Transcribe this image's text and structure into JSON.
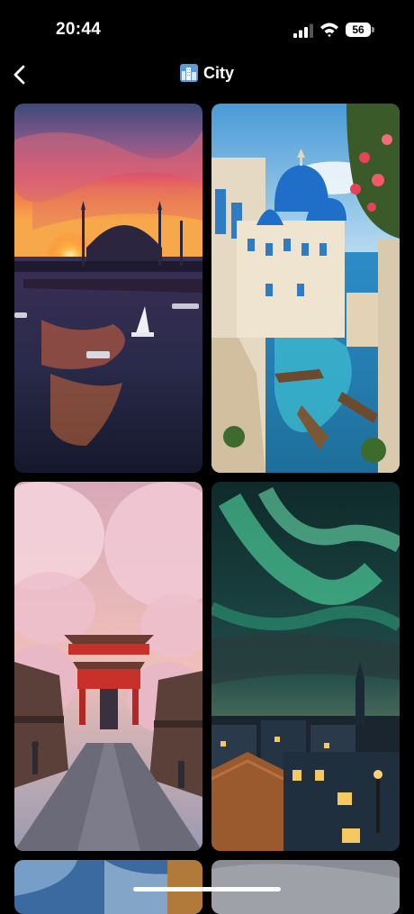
{
  "status_bar": {
    "time": "20:44",
    "battery": "56"
  },
  "header": {
    "title": "City"
  },
  "grid": {
    "items": [
      {
        "icon": "istanbul-sunset-mosque-image"
      },
      {
        "icon": "santorini-harbor-image"
      },
      {
        "icon": "japan-cherry-blossom-street-image"
      },
      {
        "icon": "northern-lights-city-image"
      },
      {
        "icon": "city-sky-partial-image"
      },
      {
        "icon": "city-cloudy-partial-image"
      }
    ]
  }
}
